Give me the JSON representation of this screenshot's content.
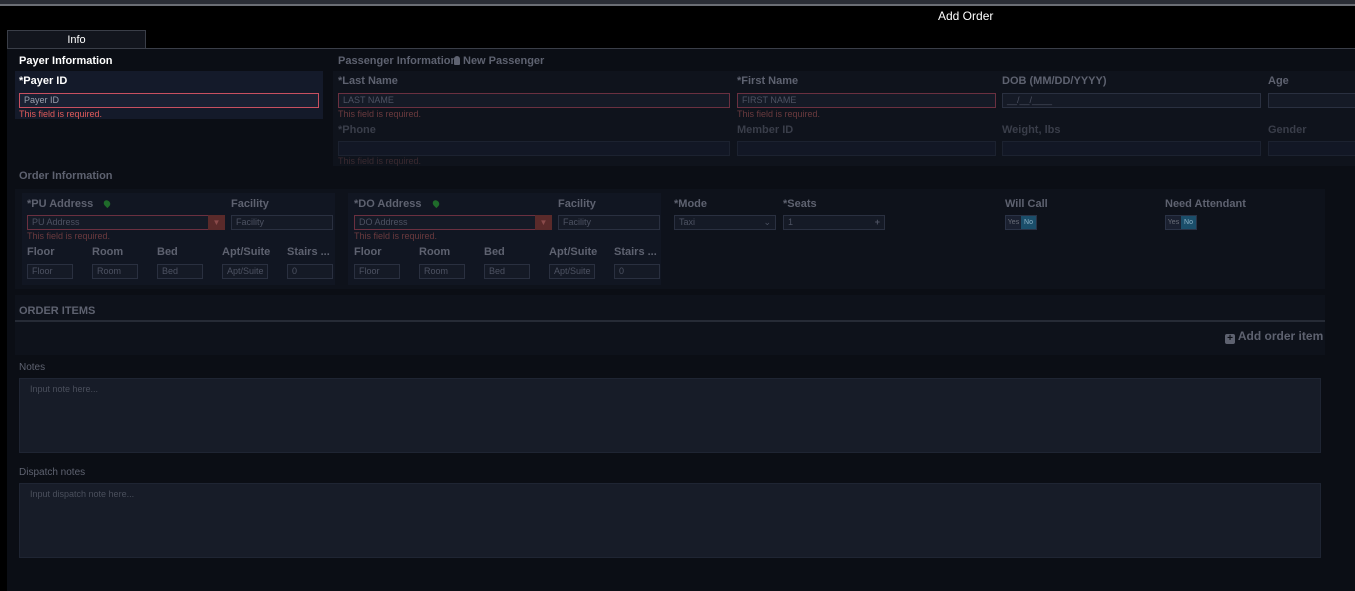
{
  "window": {
    "title": "Add Order"
  },
  "tabs": [
    {
      "label": "Info"
    }
  ],
  "payer": {
    "section": "Payer Information",
    "payer_id_label": "*Payer ID",
    "payer_id_placeholder": "Payer ID",
    "error": "This field is required."
  },
  "passenger": {
    "section": "Passenger Information",
    "new_passenger": "New Passenger",
    "last_name_label": "*Last Name",
    "last_name_placeholder": "LAST NAME",
    "first_name_label": "*First Name",
    "first_name_placeholder": "FIRST NAME",
    "dob_label": "DOB (MM/DD/YYYY)",
    "dob_placeholder": "__/__/____",
    "age_label": "Age",
    "error": "This field is required.",
    "phone_label": "*Phone",
    "member_id_label": "Member ID",
    "weight_label": "Weight, lbs",
    "gender_label": "Gender"
  },
  "order": {
    "section": "Order Information",
    "pu_address_label": "*PU Address",
    "pu_address_placeholder": "PU Address",
    "facility_label": "Facility",
    "facility_placeholder": "Facility",
    "do_address_label": "*DO Address",
    "do_address_placeholder": "DO Address",
    "error": "This field is required.",
    "floor_label": "Floor",
    "floor_placeholder": "Floor",
    "room_label": "Room",
    "room_placeholder": "Room",
    "bed_label": "Bed",
    "bed_placeholder": "Bed",
    "apt_label": "Apt/Suite",
    "apt_placeholder": "Apt/Suite",
    "stairs_label": "Stairs ...",
    "stairs_value": "0",
    "mode_label": "*Mode",
    "mode_value": "Taxi",
    "seats_label": "*Seats",
    "seats_value": "1",
    "will_call_label": "Will Call",
    "need_attendant_label": "Need Attendant",
    "toggle_yes": "Yes",
    "toggle_no": "No"
  },
  "order_items": {
    "section": "ORDER ITEMS",
    "add_label": "Add order item"
  },
  "notes": {
    "label": "Notes",
    "placeholder": "Input note here...",
    "dispatch_label": "Dispatch notes",
    "dispatch_placeholder": "Input dispatch note here..."
  }
}
